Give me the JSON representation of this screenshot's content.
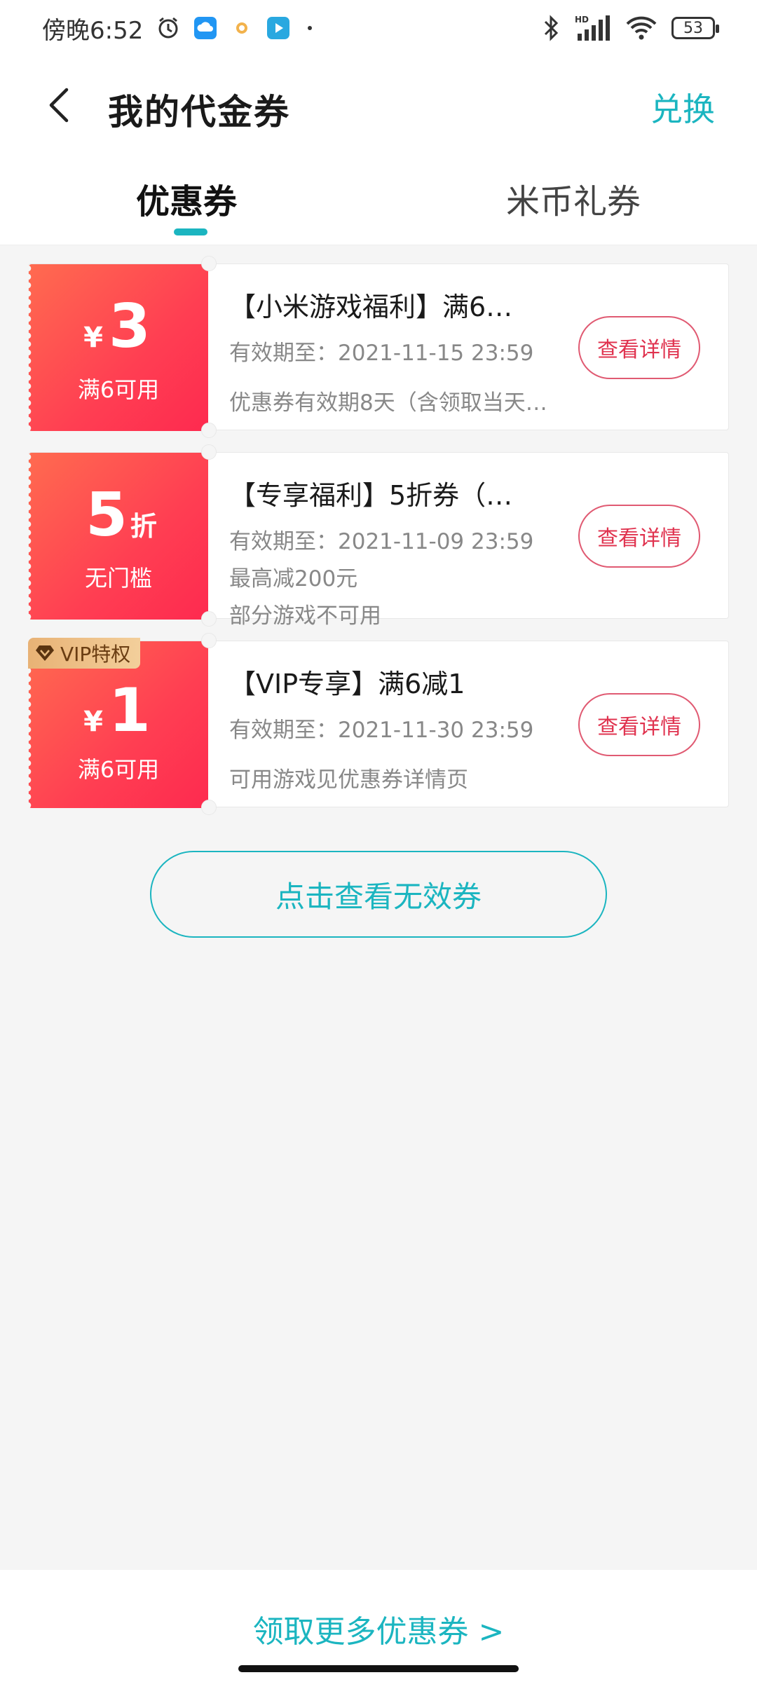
{
  "status_bar": {
    "time": "傍晚6:52",
    "battery": "53",
    "network_label": "HD",
    "icons": [
      "alarm-icon",
      "cloud-icon",
      "ring-icon",
      "video-icon",
      "dot-icon",
      "bluetooth-icon",
      "signal-icon",
      "wifi-icon",
      "battery-icon"
    ]
  },
  "header": {
    "title": "我的代金券",
    "action_label": "兑换",
    "back_icon": "chevron-left-icon"
  },
  "tabs": [
    {
      "label": "优惠券",
      "active": true
    },
    {
      "label": "米币礼券",
      "active": false
    }
  ],
  "accent_color": "#1bb5c0",
  "coupon_color": "#ff3e52",
  "coupons": [
    {
      "currency": "¥",
      "amount": "3",
      "unit": "",
      "condition": "满6可用",
      "title": "【小米游戏福利】满6…",
      "expiry": "有效期至：2021-11-15 23:59",
      "extra": "",
      "desc": "优惠券有效期8天（含领取当天…",
      "button_label": "查看详情",
      "vip": false
    },
    {
      "currency": "",
      "amount": "5",
      "unit": "折",
      "condition": "无门槛",
      "title": "【专享福利】5折券（…",
      "expiry": "有效期至：2021-11-09 23:59",
      "extra": "最高减200元",
      "desc": "部分游戏不可用",
      "button_label": "查看详情",
      "vip": false
    },
    {
      "currency": "¥",
      "amount": "1",
      "unit": "",
      "condition": "满6可用",
      "title": "【VIP专享】满6减1",
      "expiry": "有效期至：2021-11-30 23:59",
      "extra": "",
      "desc": "可用游戏见优惠券详情页",
      "button_label": "查看详情",
      "vip": true,
      "vip_label": "VIP特权"
    }
  ],
  "invalid_button_label": "点击查看无效券",
  "more_coupons_link": "领取更多优惠券 >"
}
